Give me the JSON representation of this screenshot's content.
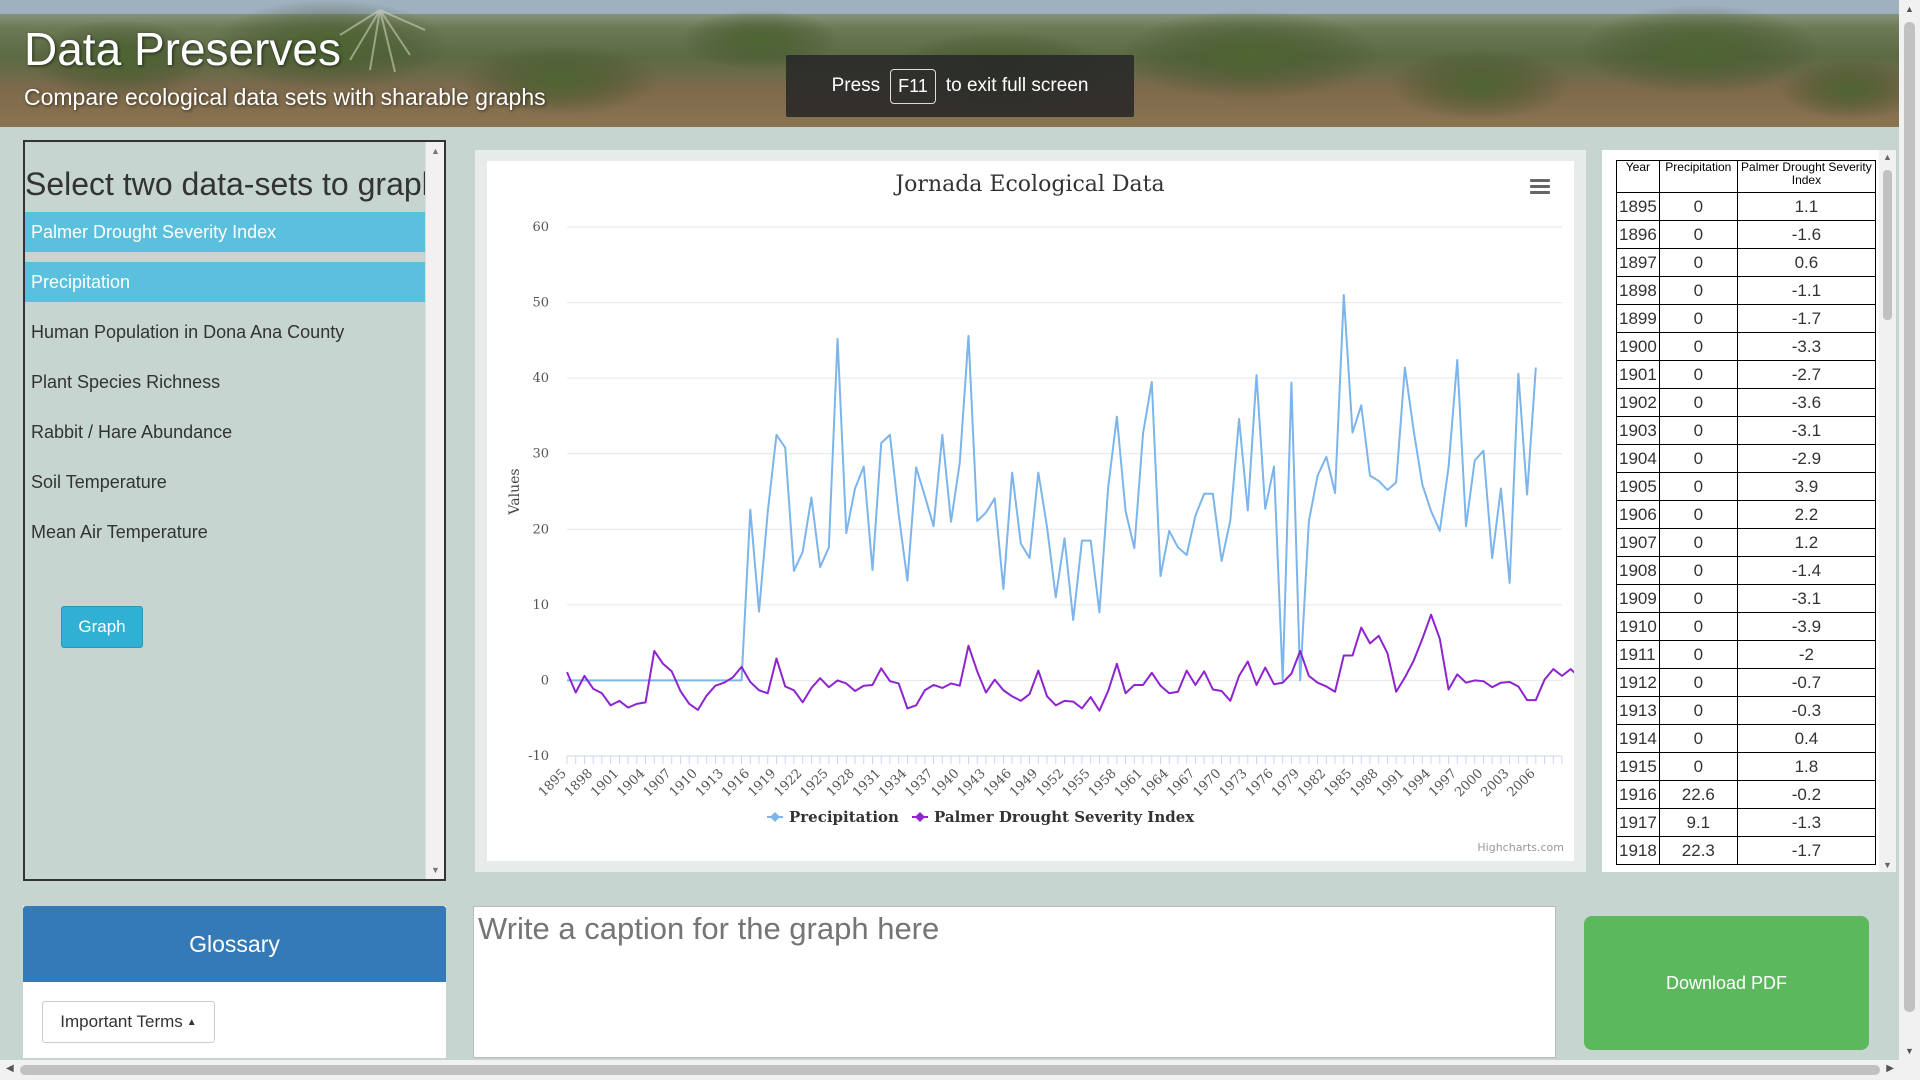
{
  "header": {
    "title": "Data Preserves",
    "subtitle": "Compare ecological data sets with sharable graphs",
    "fullscreen_notice": {
      "press": "Press",
      "key": "F11",
      "rest": "to exit full screen"
    }
  },
  "datasets": {
    "heading": "Select two data-sets to graph",
    "items": [
      {
        "label": "Palmer Drought Severity Index",
        "selected": true
      },
      {
        "label": "Precipitation",
        "selected": true
      },
      {
        "label": "Human Population in Dona Ana County",
        "selected": false
      },
      {
        "label": "Plant Species Richness",
        "selected": false
      },
      {
        "label": "Rabbit / Hare Abundance",
        "selected": false
      },
      {
        "label": "Soil Temperature",
        "selected": false
      },
      {
        "label": "Mean Air Temperature",
        "selected": false
      }
    ],
    "graph_button": "Graph"
  },
  "glossary": {
    "title": "Glossary",
    "terms_button": "Important Terms"
  },
  "caption": {
    "placeholder": "Write a caption for the graph here"
  },
  "download_button": "Download PDF",
  "chart_credit": "Highcharts.com",
  "icons": [
    "menu-icon",
    "caret-up-icon",
    "legend-line-marker-icon"
  ],
  "colors": {
    "precipitation": "#7cb5ec",
    "pdsi": "#8e24cf",
    "selected_item": "#5bc0de",
    "glossary_header": "#337ab7",
    "download": "#5cb85c"
  },
  "table": {
    "headers": [
      "Year",
      "Precipitation",
      "Palmer Drought Severity Index"
    ],
    "rows": [
      [
        "1895",
        "0",
        "1.1"
      ],
      [
        "1896",
        "0",
        "-1.6"
      ],
      [
        "1897",
        "0",
        "0.6"
      ],
      [
        "1898",
        "0",
        "-1.1"
      ],
      [
        "1899",
        "0",
        "-1.7"
      ],
      [
        "1900",
        "0",
        "-3.3"
      ],
      [
        "1901",
        "0",
        "-2.7"
      ],
      [
        "1902",
        "0",
        "-3.6"
      ],
      [
        "1903",
        "0",
        "-3.1"
      ],
      [
        "1904",
        "0",
        "-2.9"
      ],
      [
        "1905",
        "0",
        "3.9"
      ],
      [
        "1906",
        "0",
        "2.2"
      ],
      [
        "1907",
        "0",
        "1.2"
      ],
      [
        "1908",
        "0",
        "-1.4"
      ],
      [
        "1909",
        "0",
        "-3.1"
      ],
      [
        "1910",
        "0",
        "-3.9"
      ],
      [
        "1911",
        "0",
        "-2"
      ],
      [
        "1912",
        "0",
        "-0.7"
      ],
      [
        "1913",
        "0",
        "-0.3"
      ],
      [
        "1914",
        "0",
        "0.4"
      ],
      [
        "1915",
        "0",
        "1.8"
      ],
      [
        "1916",
        "22.6",
        "-0.2"
      ],
      [
        "1917",
        "9.1",
        "-1.3"
      ],
      [
        "1918",
        "22.3",
        "-1.7"
      ]
    ]
  },
  "chart_data": {
    "type": "line",
    "title": "Jornada Ecological Data",
    "ylabel": "Values",
    "ylim": [
      -10,
      60
    ],
    "yticks": [
      -10,
      0,
      10,
      20,
      30,
      40,
      50,
      60
    ],
    "x_start": 1895,
    "x_end": 2009,
    "xtick_step": 3,
    "grid": true,
    "legend": "bottom-center",
    "series": [
      {
        "name": "Precipitation",
        "color": "#7cb5ec",
        "values": [
          0,
          0,
          0,
          0,
          0,
          0,
          0,
          0,
          0,
          0,
          0,
          0,
          0,
          0,
          0,
          0,
          0,
          0,
          0,
          0,
          0,
          22.6,
          9.1,
          22.3,
          32.5,
          30.8,
          14.5,
          17,
          24.2,
          15,
          17.6,
          45.2,
          19.5,
          25.4,
          28.3,
          14.6,
          31.4,
          32.5,
          22,
          13.2,
          28.2,
          24.4,
          20.4,
          32.5,
          21,
          28.8,
          45.6,
          21.1,
          22.2,
          24.1,
          12.1,
          27.5,
          18.1,
          16.2,
          27.5,
          20.3,
          11,
          18.8,
          8,
          18.5,
          18.5,
          9,
          25.5,
          34.9,
          22.4,
          17.5,
          32.7,
          39.5,
          13.8,
          19.8,
          17.6,
          16.6,
          21.8,
          24.7,
          24.7,
          15.8,
          21.2,
          34.6,
          22.5,
          40.4,
          22.7,
          28.3,
          0,
          39.4,
          0,
          21.1,
          27.1,
          29.6,
          24.8,
          51,
          32.8,
          36.4,
          27.1,
          26.4,
          25.2,
          26.2,
          41.4,
          33.1,
          25.9,
          22.4,
          19.8,
          28.2,
          42.4,
          20.4,
          29.1,
          30.4,
          16.2,
          25.4,
          12.9,
          40.6,
          24.6,
          41.4
        ]
      },
      {
        "name": "Palmer Drought Severity Index",
        "color": "#8e24cf",
        "values": [
          1.1,
          -1.6,
          0.6,
          -1.1,
          -1.7,
          -3.3,
          -2.7,
          -3.6,
          -3.1,
          -2.9,
          3.9,
          2.2,
          1.2,
          -1.4,
          -3.1,
          -3.9,
          -2,
          -0.7,
          -0.3,
          0.4,
          1.8,
          -0.2,
          -1.3,
          -1.7,
          2.9,
          -0.8,
          -1.3,
          -2.9,
          -1,
          0.3,
          -0.9,
          0,
          -0.4,
          -1.4,
          -0.7,
          -0.6,
          1.6,
          -0.1,
          -0.4,
          -3.7,
          -3.3,
          -1.3,
          -0.6,
          -1,
          -0.4,
          -0.7,
          4.6,
          1.2,
          -1.6,
          0.1,
          -1.3,
          -2.1,
          -2.7,
          -1.8,
          1.3,
          -2.1,
          -3.3,
          -2.7,
          -2.8,
          -3.7,
          -2.2,
          -4,
          -1.4,
          2.2,
          -1.7,
          -0.6,
          -0.6,
          1,
          -0.7,
          -1.7,
          -1.5,
          1.3,
          -0.6,
          1.2,
          -1.2,
          -1.4,
          -2.7,
          0.6,
          2.5,
          -0.6,
          1.7,
          -0.5,
          -0.3,
          0.9,
          3.9,
          0.6,
          -0.3,
          -0.8,
          -1.5,
          3.3,
          3.3,
          7,
          4.9,
          5.9,
          3.6,
          -1.5,
          0.4,
          2.6,
          5.5,
          8.7,
          5.5,
          -1.2,
          0.8,
          -0.3,
          0,
          -0.1,
          -0.9,
          -0.3,
          -0.2,
          -0.8,
          -2.6,
          -2.6,
          0.1,
          1.5,
          0.6,
          1.5,
          0.4
        ]
      }
    ]
  }
}
